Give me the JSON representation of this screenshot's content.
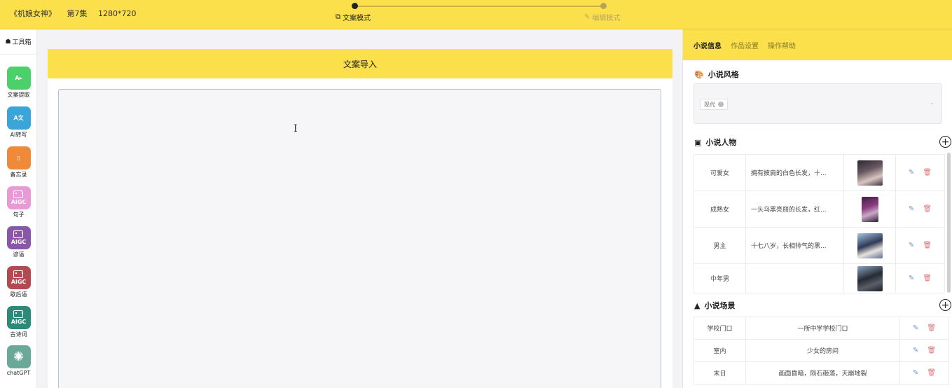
{
  "header": {
    "project_title": "《机娘女神》",
    "episode": "第7集",
    "resolution": "1280*720",
    "steps": [
      {
        "label": "文案模式",
        "icon": "copy-icon",
        "active": true
      },
      {
        "label": "编辑模式",
        "icon": "edit-icon",
        "active": false
      }
    ],
    "accent_color": "#fbe04c"
  },
  "toolbox": {
    "title": "工具箱",
    "items": [
      {
        "label": "文案提取",
        "icon": "text-extract-icon",
        "color": "#4cd06a"
      },
      {
        "label": "AI转写",
        "icon": "ai-rewrite-icon",
        "color": "#3ba4d8"
      },
      {
        "label": "备忘录",
        "icon": "memo-icon",
        "color": "#f08a3b"
      },
      {
        "label": "句子",
        "icon": "aigc-icon",
        "color": "#e79ad6",
        "badge": "AIGC"
      },
      {
        "label": "谚语",
        "icon": "aigc-icon",
        "color": "#8957a8",
        "badge": "AIGC"
      },
      {
        "label": "歇后语",
        "icon": "aigc-icon",
        "color": "#b34a52",
        "badge": "AIGC"
      },
      {
        "label": "古诗词",
        "icon": "aigc-icon",
        "color": "#2e8a78",
        "badge": "AIGC"
      },
      {
        "label": "chatGPT",
        "icon": "chatgpt-icon",
        "color": "#6aa898"
      }
    ]
  },
  "editor": {
    "title": "文案导入",
    "content": ""
  },
  "right_panel": {
    "tabs": [
      {
        "label": "小说信息",
        "active": true
      },
      {
        "label": "作品设置",
        "active": false
      },
      {
        "label": "操作帮助",
        "active": false
      }
    ],
    "style_section": {
      "title": "小说风格",
      "selected_tag": "现代"
    },
    "characters_section": {
      "title": "小说人物",
      "rows": [
        {
          "name": "可爱女",
          "desc": "拥有披肩的白色长发，十...",
          "thumb": "a"
        },
        {
          "name": "成熟女",
          "desc": "一头乌黑亮丽的长发，红...",
          "thumb": "b"
        },
        {
          "name": "男主",
          "desc": "十七八岁，长相帅气的黑...",
          "thumb": "c"
        },
        {
          "name": "中年男",
          "desc": "",
          "thumb": "d"
        }
      ]
    },
    "scenes_section": {
      "title": "小说场景",
      "rows": [
        {
          "name": "学校门口",
          "desc": "一所中学学校门口"
        },
        {
          "name": "室内",
          "desc": "少女的房间"
        },
        {
          "name": "末日",
          "desc": "画面昏暗，陨石砸落，天崩地裂"
        }
      ]
    }
  }
}
